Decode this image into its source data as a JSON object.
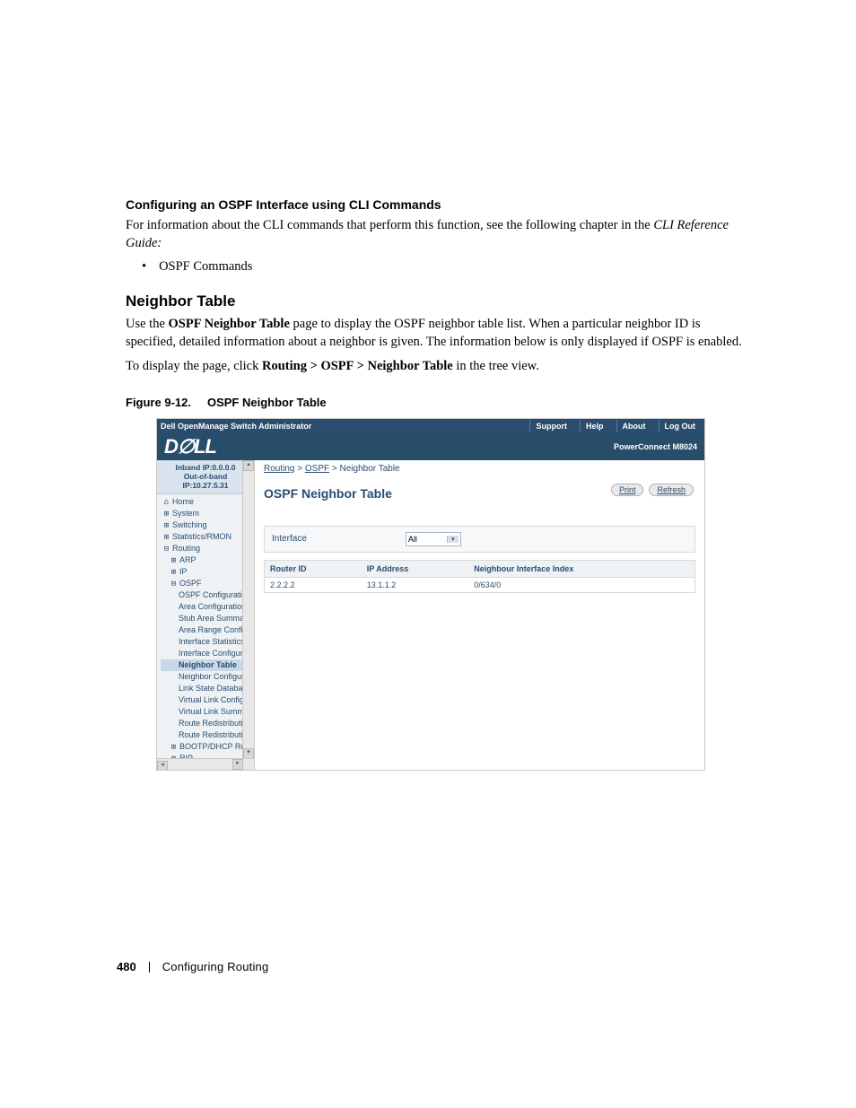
{
  "headings": {
    "h3_configure_cli": "Configuring an OSPF Interface using CLI Commands",
    "h2_neighbor_table": "Neighbor Table"
  },
  "paragraphs": {
    "p1a": "For information about the CLI commands that perform this function, see the following chapter in the ",
    "p1b": "CLI Reference Guide:",
    "bullet1": "OSPF Commands",
    "p2a": "Use the ",
    "p2b": "OSPF Neighbor Table",
    "p2c": " page to display the OSPF neighbor table list. When a particular neighbor ID is specified, detailed information about a neighbor is given. The information below is only displayed if OSPF is enabled.",
    "p3a": "To display the page, click ",
    "p3b": "Routing > OSPF > Neighbor Table",
    "p3c": " in the tree view."
  },
  "figure_caption": {
    "num": "Figure 9-12.",
    "title": "OSPF Neighbor Table"
  },
  "screenshot": {
    "topbar": {
      "title": "Dell OpenManage Switch Administrator",
      "links": [
        "Support",
        "Help",
        "About",
        "Log Out"
      ]
    },
    "product": "PowerConnect M8024",
    "ip": {
      "inband": "Inband IP:0.0.0.0",
      "oob": "Out-of-band IP:10.27.5.31"
    },
    "tree": {
      "home": "Home",
      "system": "System",
      "switching": "Switching",
      "stats": "Statistics/RMON",
      "routing": "Routing",
      "arp": "ARP",
      "ip": "IP",
      "ospf": "OSPF",
      "ospf_children": [
        "OSPF Configuratio",
        "Area Configuration",
        "Stub Area Summa",
        "Area Range Config",
        "Interface Statistics",
        "Interface Configura",
        "Neighbor Table",
        "Neighbor Configura",
        "Link State Databa",
        "Virtual Link Config",
        "Virtual Link Summ",
        "Route Redistributio",
        "Route Redistributio"
      ],
      "bootp": "BOOTP/DHCP Relay",
      "rip": "RIP"
    },
    "breadcrumb": [
      "Routing",
      "OSPF",
      "Neighbor Table"
    ],
    "main_title": "OSPF Neighbor Table",
    "buttons": {
      "print": "Print",
      "refresh": "Refresh"
    },
    "filter": {
      "label": "Interface",
      "value": "All"
    },
    "table": {
      "headers": [
        "Router ID",
        "IP Address",
        "Neighbour Interface Index"
      ],
      "row": [
        "2.2.2.2",
        "13.1.1.2",
        "0/634/0"
      ]
    }
  },
  "footer": {
    "page": "480",
    "section": "Configuring Routing"
  }
}
